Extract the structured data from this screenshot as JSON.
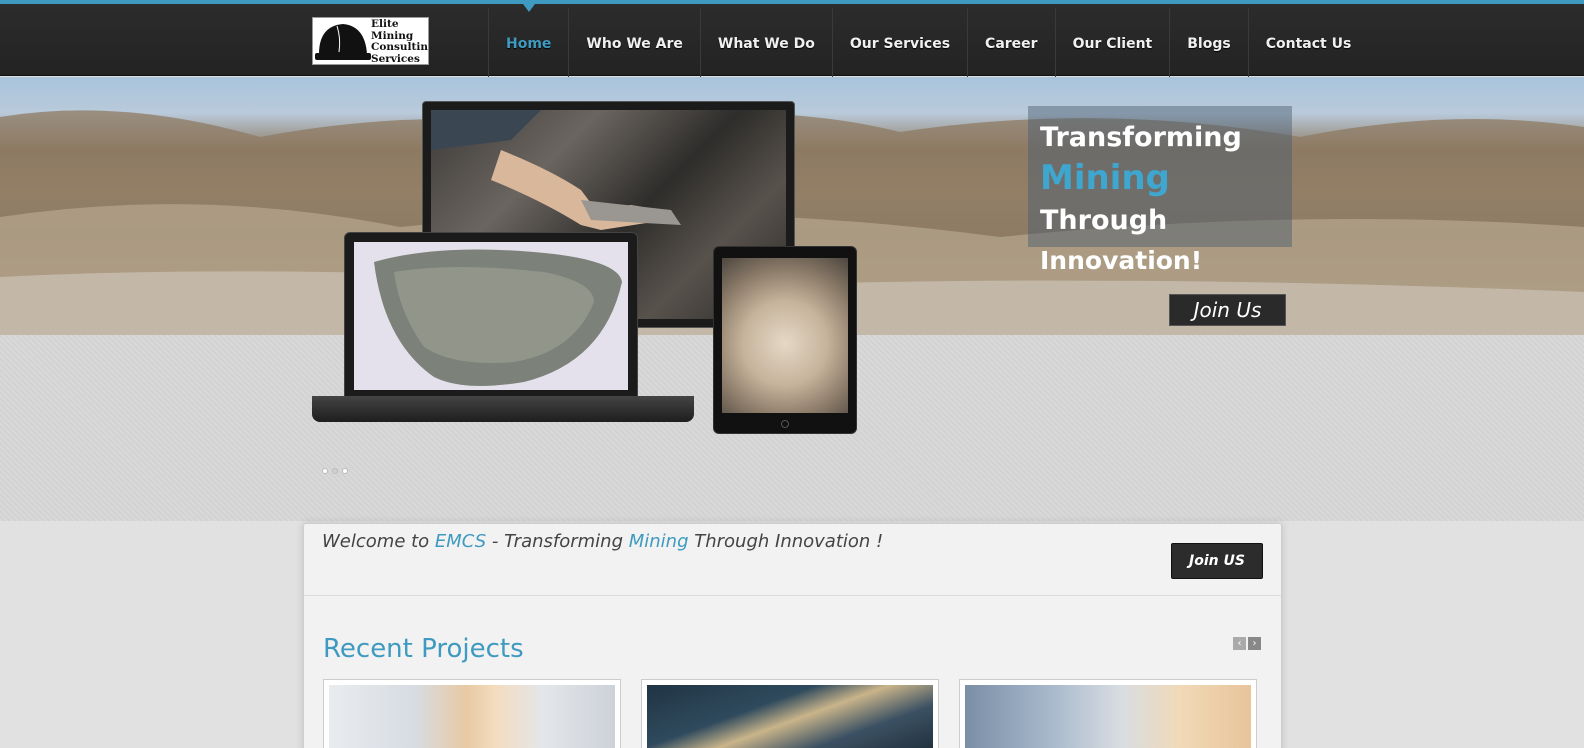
{
  "header": {
    "logo": {
      "line1": "Elite",
      "line2": "Mining",
      "line3": "Consulting",
      "line4": "Services",
      "helmet_text": [
        "Transforming",
        "Mining",
        "Through",
        "Innovation"
      ]
    },
    "nav": [
      {
        "label": "Home",
        "active": true
      },
      {
        "label": "Who We Are",
        "active": false
      },
      {
        "label": "What We Do",
        "active": false
      },
      {
        "label": "Our Services",
        "active": false
      },
      {
        "label": "Career",
        "active": false
      },
      {
        "label": "Our Client",
        "active": false
      },
      {
        "label": "Blogs",
        "active": false
      },
      {
        "label": "Contact Us",
        "active": false
      }
    ]
  },
  "hero": {
    "caption": {
      "line1": "Transforming",
      "accent": "Mining",
      "line2_rest": "Through",
      "line3": "Innovation!"
    },
    "join_label": "Join Us",
    "slides": 3,
    "active_slide": 1
  },
  "welcome": {
    "prefix": "Welcome to ",
    "brand": "EMCS",
    "middle": " - Transforming ",
    "accent": "Mining",
    "suffix": " Through Innovation !",
    "join_label": "Join US"
  },
  "projects": {
    "title": "Recent Projects",
    "prev_icon": "‹",
    "next_icon": "›"
  },
  "colors": {
    "accent": "#3e9ac0",
    "header_bg": "#2a2a2a"
  }
}
